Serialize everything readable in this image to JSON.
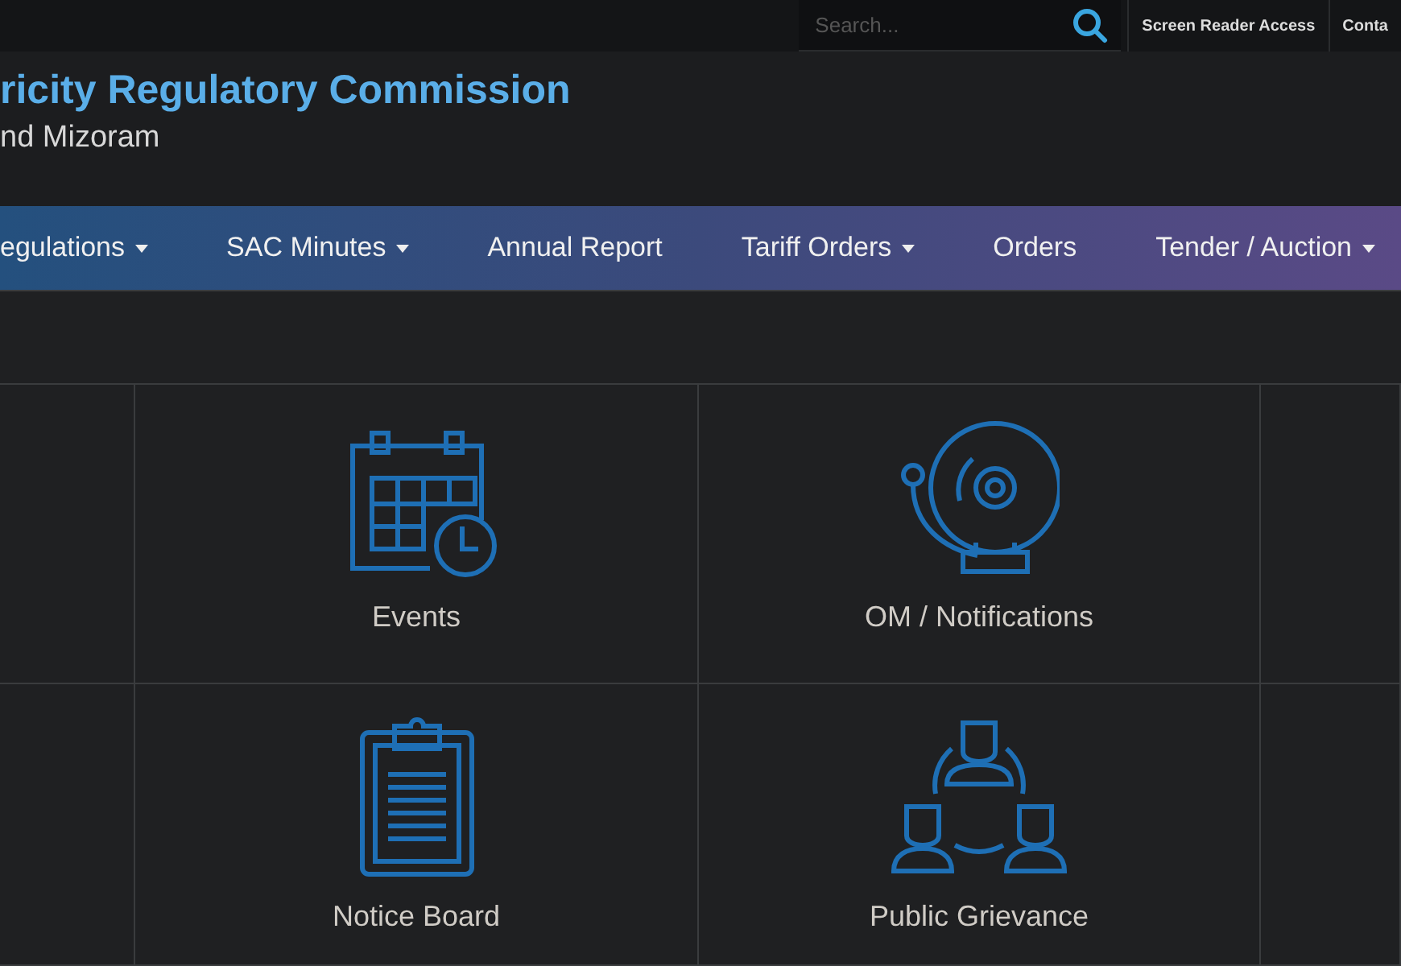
{
  "top_bar": {
    "search": {
      "placeholder": "Search..."
    },
    "links": [
      "Screen Reader Access",
      "Conta"
    ]
  },
  "header": {
    "title": "ricity Regulatory Commission",
    "subtitle": "nd Mizoram"
  },
  "nav": [
    {
      "label": "egulations",
      "dropdown": true
    },
    {
      "label": "SAC Minutes",
      "dropdown": true
    },
    {
      "label": "Annual Report",
      "dropdown": false
    },
    {
      "label": "Tariff Orders",
      "dropdown": true
    },
    {
      "label": "Orders",
      "dropdown": false
    },
    {
      "label": "Tender / Auction",
      "dropdown": true
    }
  ],
  "tiles": [
    {
      "kind": "empty"
    },
    {
      "kind": "calendar",
      "label": "Events"
    },
    {
      "kind": "bell",
      "label": "OM / Notifications"
    },
    {
      "kind": "empty"
    },
    {
      "kind": "empty"
    },
    {
      "kind": "clipboard",
      "label": "Notice Board"
    },
    {
      "kind": "people",
      "label": "Public Grievance"
    },
    {
      "kind": "empty"
    }
  ]
}
